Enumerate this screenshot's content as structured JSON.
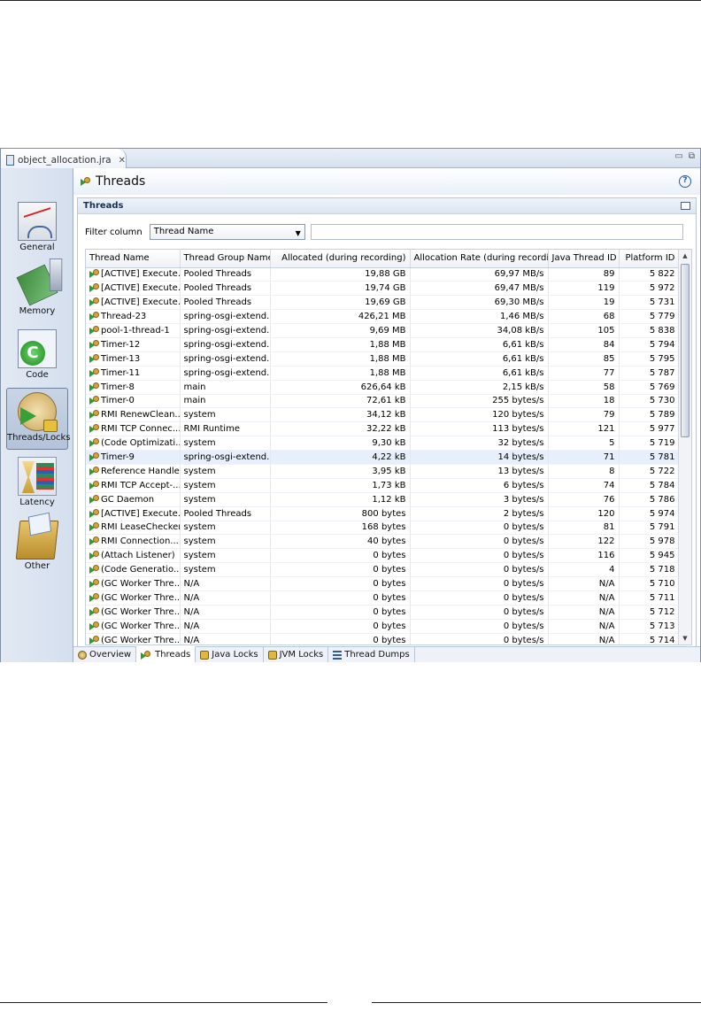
{
  "editor_tab": {
    "title": "object_allocation.jra",
    "close": "✕"
  },
  "window_controls": {
    "minimize": "▭",
    "restore": "⧉"
  },
  "nav": [
    {
      "label": "General",
      "icon": "general-chart-icon"
    },
    {
      "label": "Memory",
      "icon": "memory-chip-icon"
    },
    {
      "label": "Code",
      "icon": "code-icon"
    },
    {
      "label": "Threads/Locks",
      "icon": "threads-locks-icon",
      "selected": true
    },
    {
      "label": "Latency",
      "icon": "latency-hourglass-icon"
    },
    {
      "label": "Other",
      "icon": "other-box-icon"
    }
  ],
  "page": {
    "title": "Threads",
    "help": "?"
  },
  "section": {
    "title": "Threads"
  },
  "filter": {
    "label": "Filter column",
    "selected": "Thread Name",
    "value": ""
  },
  "table": {
    "headers": [
      "Thread Name",
      "Thread Group Name",
      "Allocated (during recording)",
      "Allocation Rate (during recordi...",
      "Java Thread ID",
      "Platform ID"
    ],
    "rows": [
      [
        "[ACTIVE] Execute...",
        "Pooled Threads",
        "19,88 GB",
        "69,97 MB/s",
        "89",
        "5 822"
      ],
      [
        "[ACTIVE] Execute...",
        "Pooled Threads",
        "19,74 GB",
        "69,47 MB/s",
        "119",
        "5 972"
      ],
      [
        "[ACTIVE] Execute...",
        "Pooled Threads",
        "19,69 GB",
        "69,30 MB/s",
        "19",
        "5 731"
      ],
      [
        "Thread-23",
        "spring-osgi-extend...",
        "426,21 MB",
        "1,46 MB/s",
        "68",
        "5 779"
      ],
      [
        "pool-1-thread-1",
        "spring-osgi-extend...",
        "9,69 MB",
        "34,08 kB/s",
        "105",
        "5 838"
      ],
      [
        "Timer-12",
        "spring-osgi-extend...",
        "1,88 MB",
        "6,61 kB/s",
        "84",
        "5 794"
      ],
      [
        "Timer-13",
        "spring-osgi-extend...",
        "1,88 MB",
        "6,61 kB/s",
        "85",
        "5 795"
      ],
      [
        "Timer-11",
        "spring-osgi-extend...",
        "1,88 MB",
        "6,61 kB/s",
        "77",
        "5 787"
      ],
      [
        "Timer-8",
        "main",
        "626,64 kB",
        "2,15 kB/s",
        "58",
        "5 769"
      ],
      [
        "Timer-0",
        "main",
        "72,61 kB",
        "255 bytes/s",
        "18",
        "5 730"
      ],
      [
        "RMI RenewClean...",
        "system",
        "34,12 kB",
        "120 bytes/s",
        "79",
        "5 789"
      ],
      [
        "RMI TCP Connec...",
        "RMI Runtime",
        "32,22 kB",
        "113 bytes/s",
        "121",
        "5 977"
      ],
      [
        "(Code Optimizati...",
        "system",
        "9,30 kB",
        "32 bytes/s",
        "5",
        "5 719"
      ],
      [
        "Timer-9",
        "spring-osgi-extend...",
        "4,22 kB",
        "14 bytes/s",
        "71",
        "5 781"
      ],
      [
        "Reference Handler",
        "system",
        "3,95 kB",
        "13 bytes/s",
        "8",
        "5 722"
      ],
      [
        "RMI TCP Accept-...",
        "system",
        "1,73 kB",
        "6 bytes/s",
        "74",
        "5 784"
      ],
      [
        "GC Daemon",
        "system",
        "1,12 kB",
        "3 bytes/s",
        "76",
        "5 786"
      ],
      [
        "[ACTIVE] Execute...",
        "Pooled Threads",
        "800 bytes",
        "2 bytes/s",
        "120",
        "5 974"
      ],
      [
        "RMI LeaseChecker",
        "system",
        "168 bytes",
        "0 bytes/s",
        "81",
        "5 791"
      ],
      [
        "RMI Connection...",
        "system",
        "40 bytes",
        "0 bytes/s",
        "122",
        "5 978"
      ],
      [
        "(Attach Listener)",
        "system",
        "0 bytes",
        "0 bytes/s",
        "116",
        "5 945"
      ],
      [
        "(Code Generatio...",
        "system",
        "0 bytes",
        "0 bytes/s",
        "4",
        "5 718"
      ],
      [
        "(GC Worker Thre...",
        "N/A",
        "0 bytes",
        "0 bytes/s",
        "N/A",
        "5 710"
      ],
      [
        "(GC Worker Thre...",
        "N/A",
        "0 bytes",
        "0 bytes/s",
        "N/A",
        "5 711"
      ],
      [
        "(GC Worker Thre...",
        "N/A",
        "0 bytes",
        "0 bytes/s",
        "N/A",
        "5 712"
      ],
      [
        "(GC Worker Thre...",
        "N/A",
        "0 bytes",
        "0 bytes/s",
        "N/A",
        "5 713"
      ],
      [
        "(GC Worker Thre...",
        "N/A",
        "0 bytes",
        "0 bytes/s",
        "N/A",
        "5 714"
      ]
    ],
    "selected_row": 13
  },
  "bottom_tabs": [
    {
      "label": "Overview",
      "icon": "overview-icon"
    },
    {
      "label": "Threads",
      "icon": "thread-icon",
      "active": true
    },
    {
      "label": "Java Locks",
      "icon": "java-lock-icon"
    },
    {
      "label": "JVM Locks",
      "icon": "jvm-lock-icon"
    },
    {
      "label": "Thread Dumps",
      "icon": "thread-dumps-icon"
    }
  ]
}
